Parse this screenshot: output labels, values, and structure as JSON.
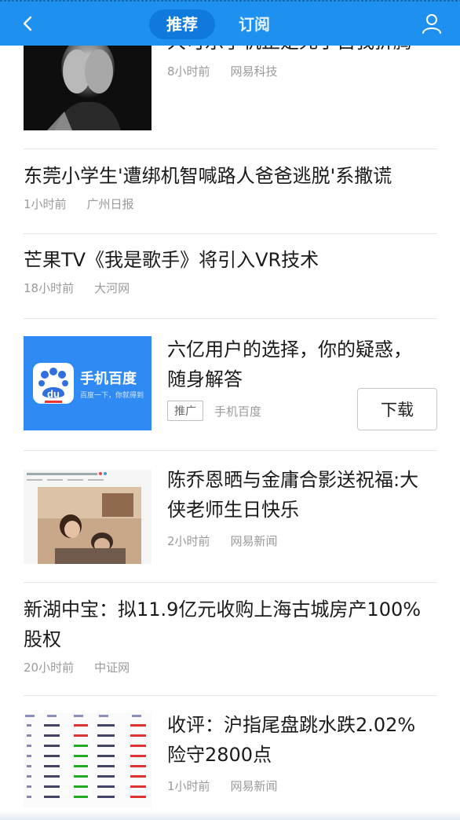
{
  "header": {
    "back_icon": "chevron-left-icon",
    "tabs": [
      {
        "label": "推荐",
        "active": true
      },
      {
        "label": "订阅",
        "active": false
      }
    ],
    "user_icon": "user-icon",
    "bg_color": "#1e90f0"
  },
  "feed": [
    {
      "type": "thumb-article",
      "title": "大可乐手机正是死于自我折腾",
      "time": "8小时前",
      "source": "网易科技"
    },
    {
      "type": "text-article",
      "title": "东莞小学生'遭绑机智喊路人爸爸逃脱'系撒谎",
      "time": "1小时前",
      "source": "广州日报"
    },
    {
      "type": "text-article",
      "title": "芒果TV《我是歌手》将引入VR技术",
      "time": "18小时前",
      "source": "大河网"
    },
    {
      "type": "ad",
      "title_line1": "六亿用户的选择，你的疑惑，",
      "title_line2": "随身解答",
      "tag": "推广",
      "source": "手机百度",
      "button": "下载",
      "thumb_name": "手机百度",
      "thumb_slogan": "百度一下，你就得到",
      "thumb_logo": "du"
    },
    {
      "type": "thumb-article",
      "title_line1": "陈乔恩晒与金庸合影送祝福:大",
      "title_line2": "侠老师生日快乐",
      "time": "2小时前",
      "source": "网易新闻"
    },
    {
      "type": "text-article",
      "title_line1": "新湖中宝：拟11.9亿元收购上海古城房产100%",
      "title_line2": "股权",
      "time": "20小时前",
      "source": "中证网"
    },
    {
      "type": "thumb-article",
      "title_line1": "收评：沪指尾盘跳水跌2.02%",
      "title_line2": "险守2800点",
      "time": "1小时前",
      "source": "网易新闻"
    }
  ]
}
